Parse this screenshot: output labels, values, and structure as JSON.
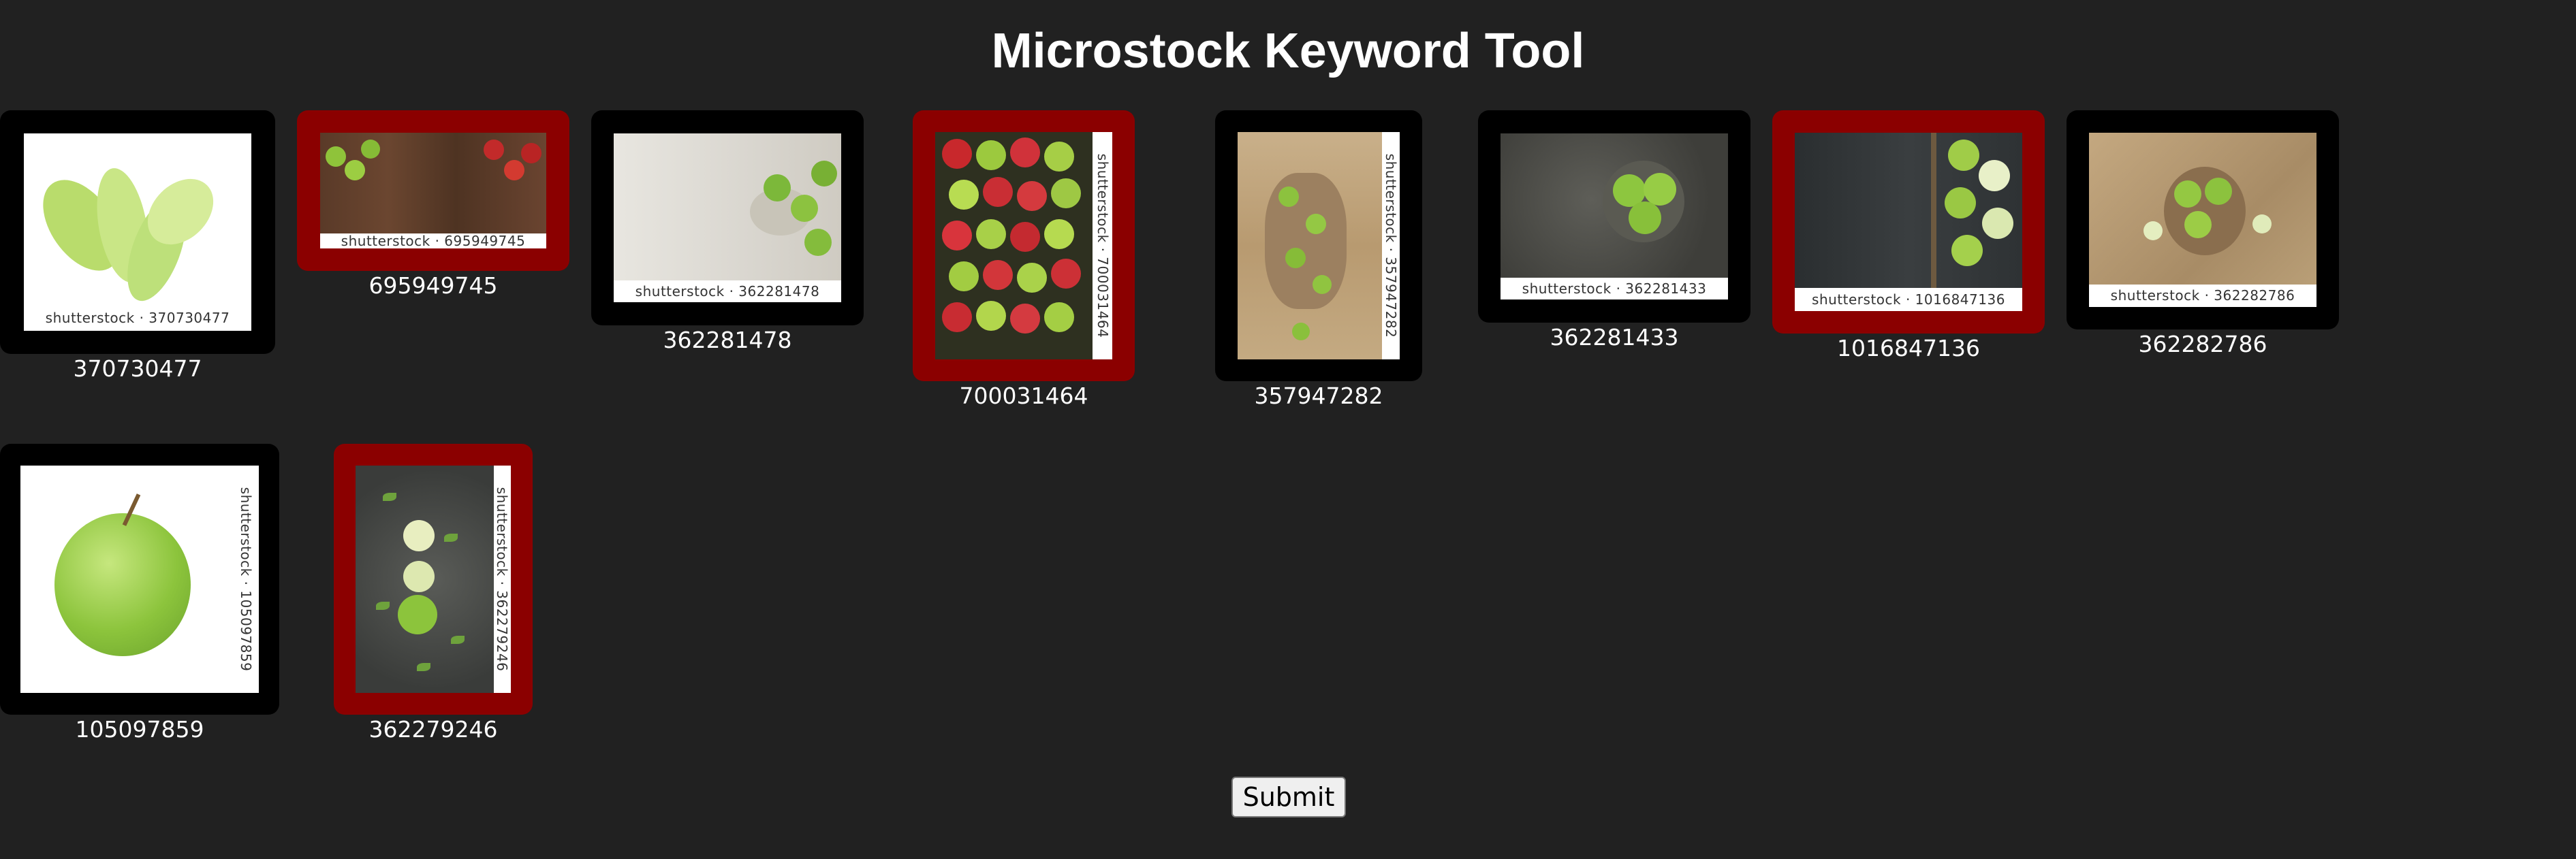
{
  "title": "Microstock Keyword Tool",
  "watermark_prefix": "shutterstock · ",
  "images": [
    {
      "id": "370730477",
      "selected": false,
      "watermark": "shutterstock · 370730477"
    },
    {
      "id": "695949745",
      "selected": true,
      "watermark": "shutterstock · 695949745"
    },
    {
      "id": "362281478",
      "selected": false,
      "watermark": "shutterstock · 362281478"
    },
    {
      "id": "700031464",
      "selected": true,
      "watermark": "shutterstock · 700031464"
    },
    {
      "id": "357947282",
      "selected": false,
      "watermark": "shutterstock · 357947282"
    },
    {
      "id": "362281433",
      "selected": false,
      "watermark": "shutterstock · 362281433"
    },
    {
      "id": "1016847136",
      "selected": true,
      "watermark": "shutterstock · 1016847136"
    },
    {
      "id": "362282786",
      "selected": false,
      "watermark": "shutterstock · 362282786"
    },
    {
      "id": "105097859",
      "selected": false,
      "watermark": "shutterstock · 105097859"
    },
    {
      "id": "362279246",
      "selected": true,
      "watermark": "shutterstock · 362279246"
    }
  ],
  "submit_label": "Submit",
  "colors": {
    "background": "#212121",
    "frame": "#000000",
    "selected_frame": "#8b0000"
  }
}
